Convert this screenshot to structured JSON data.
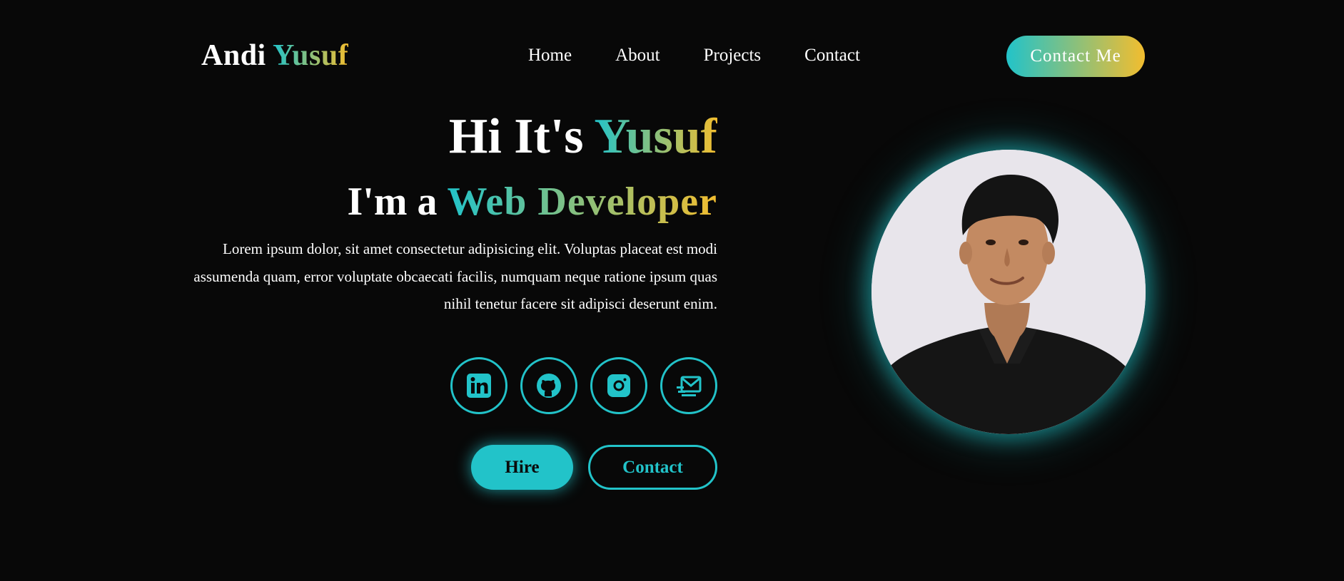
{
  "header": {
    "logo_first": "Andi",
    "logo_second": "Yusuf",
    "nav": [
      "Home",
      "About",
      "Projects",
      "Contact"
    ],
    "cta_label": "Contact Me"
  },
  "hero": {
    "greeting_prefix": "Hi It's",
    "greeting_name": "Yusuf",
    "role_prefix": "I'm a",
    "role": "Web Developer",
    "description": "Lorem ipsum dolor, sit amet consectetur adipisicing elit. Voluptas placeat est modi assumenda quam, error voluptate obcaecati facilis, numquam neque ratione ipsum quas nihil tenetur facere sit adipisci deserunt enim.",
    "socials": [
      {
        "icon": "linkedin-icon"
      },
      {
        "icon": "github-icon"
      },
      {
        "icon": "instagram-icon"
      },
      {
        "icon": "mail-send-icon"
      }
    ],
    "hire_label": "Hire",
    "contact_label": "Contact"
  },
  "colors": {
    "background": "#080808",
    "accent": "#22c3c9",
    "gradient_end": "#f2bd2f"
  }
}
